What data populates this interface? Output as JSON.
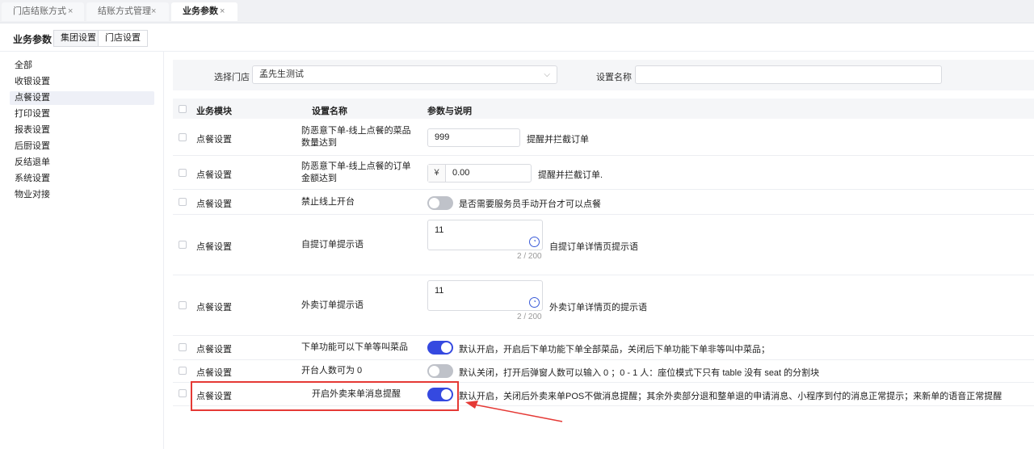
{
  "tabs": [
    {
      "label": "门店结账方式",
      "close": "×"
    },
    {
      "label": "结账方式管理",
      "close": "×"
    },
    {
      "label": "业务参数",
      "close": "×"
    }
  ],
  "header": {
    "title": "业务参数",
    "buttons": [
      "集团设置",
      "门店设置"
    ]
  },
  "sidebar": {
    "items": [
      "全部",
      "收银设置",
      "点餐设置",
      "打印设置",
      "报表设置",
      "后厨设置",
      "反结退单",
      "系统设置",
      "物业对接"
    ]
  },
  "filter": {
    "store_label": "选择门店",
    "store_value": "孟先生测试",
    "name_label": "设置名称",
    "name_value": ""
  },
  "table": {
    "headers": [
      "业务模块",
      "设置名称",
      "参数与说明"
    ],
    "rows": [
      {
        "module": "点餐设置",
        "name": "防恶意下单-线上点餐的菜品数量达到",
        "value": "999",
        "desc": "提醒并拦截订单"
      },
      {
        "module": "点餐设置",
        "name": "防恶意下单-线上点餐的订单金额达到",
        "prefix": "¥",
        "value": "0.00",
        "desc": "提醒并拦截订单."
      },
      {
        "module": "点餐设置",
        "name": "禁止线上开台",
        "toggle": "off",
        "desc": "是否需要服务员手动开台才可以点餐"
      },
      {
        "module": "点餐设置",
        "name": "自提订单提示语",
        "value": "11",
        "count": "2 / 200",
        "desc": "自提订单详情页提示语"
      },
      {
        "module": "点餐设置",
        "name": "外卖订单提示语",
        "value": "11",
        "count": "2 / 200",
        "desc": "外卖订单详情页的提示语"
      },
      {
        "module": "点餐设置",
        "name": "下单功能可以下单等叫菜品",
        "toggle": "on",
        "desc": "默认开启，开启后下单功能下单全部菜品，关闭后下单功能下单非等叫中菜品；"
      },
      {
        "module": "点餐设置",
        "name": "开台人数可为 0",
        "toggle": "off",
        "desc": "默认关闭，打开后弹窗人数可以输入 0 ；0 - 1 人：座位模式下只有 table 没有 seat 的分割块"
      },
      {
        "module": "点餐设置",
        "name": "开启外卖来单消息提醒",
        "toggle": "on",
        "desc": "默认开启，关闭后外卖来单POS不做消息提醒；其余外卖部分退和整单退的申请消息、小程序到付的消息正常提示；来新单的语音正常提醒"
      }
    ]
  },
  "colors": {
    "accent": "#3549e0",
    "highlight": "#e53935"
  }
}
